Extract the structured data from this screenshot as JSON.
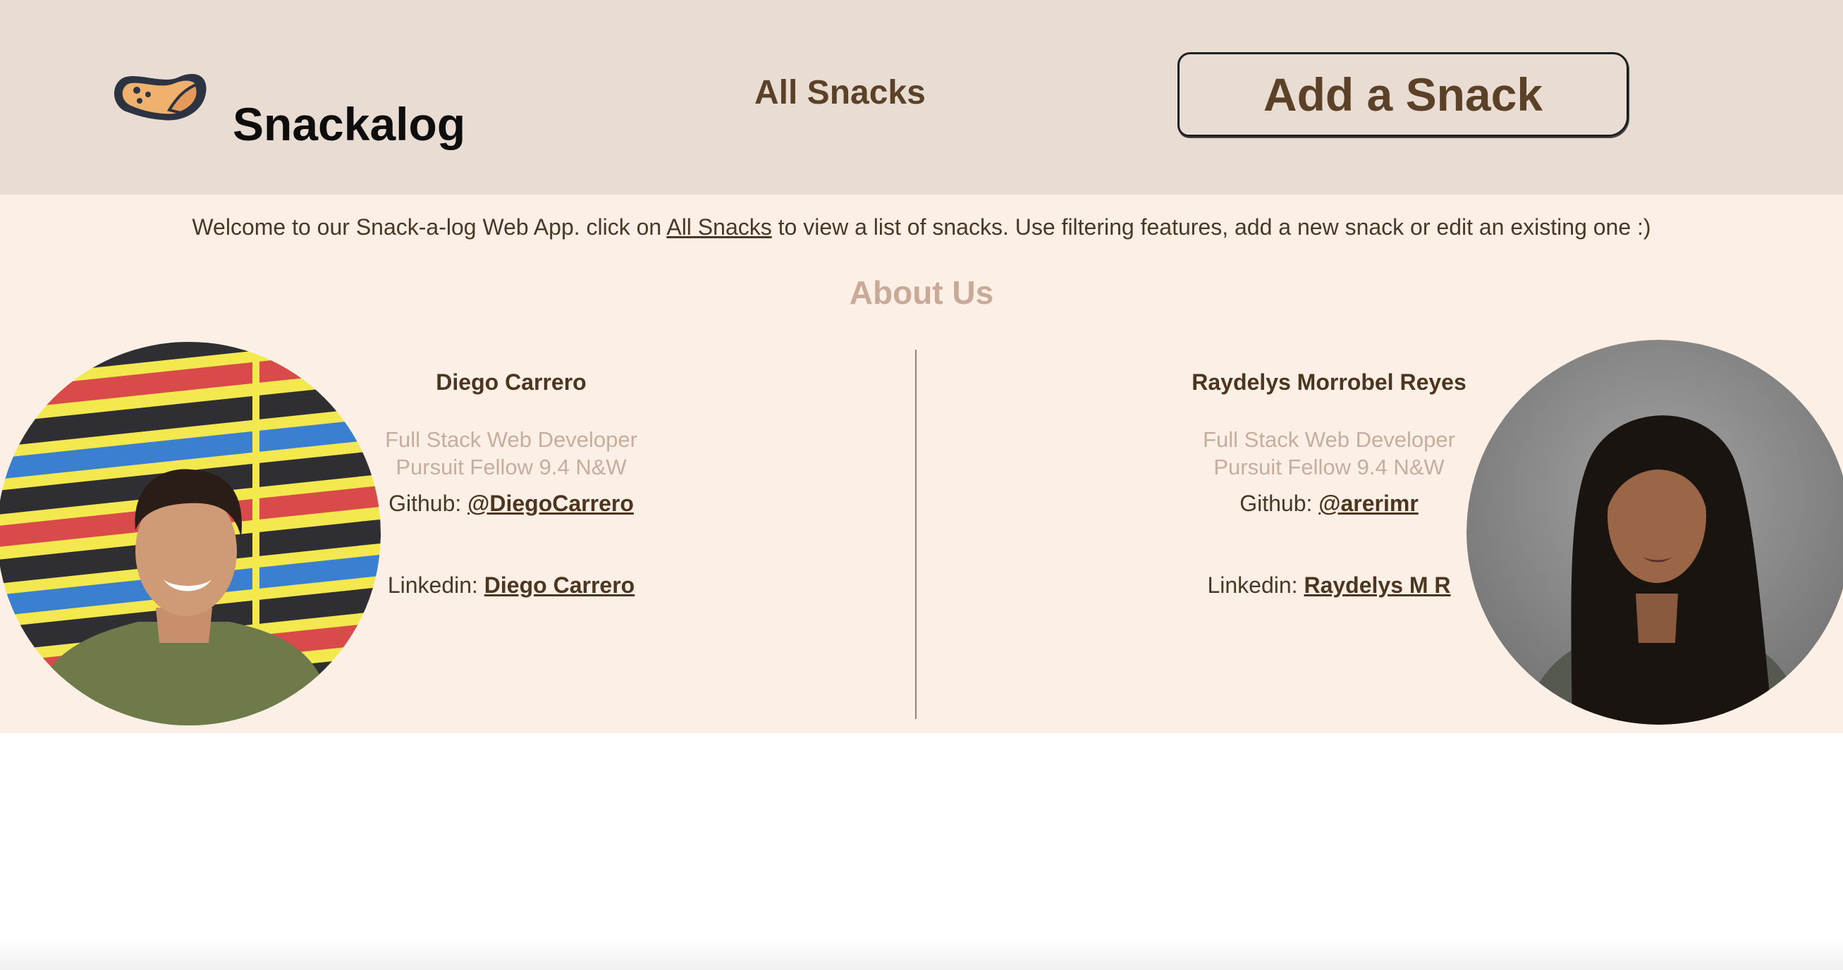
{
  "header": {
    "brand": "Snackalog",
    "nav_all_snacks": "All Snacks",
    "add_snack": "Add a Snack"
  },
  "welcome": {
    "prefix": "Welcome to our Snack-a-log Web App. click on ",
    "link": "All Snacks",
    "suffix": " to view a list of snacks. Use filtering features, add a new snack or edit an existing one :)"
  },
  "about": {
    "title": "About Us",
    "members": [
      {
        "name": "Diego Carrero",
        "role": "Full Stack Web Developer",
        "fellow": "Pursuit Fellow 9.4 N&W",
        "github_label": "Github: ",
        "github_handle": "@DiegoCarrero",
        "linkedin_label": "Linkedin: ",
        "linkedin_name": "Diego Carrero"
      },
      {
        "name": "Raydelys Morrobel Reyes",
        "role": "Full Stack Web Developer",
        "fellow": "Pursuit Fellow 9.4 N&W",
        "github_label": "Github: ",
        "github_handle": "@arerimr",
        "linkedin_label": "Linkedin: ",
        "linkedin_name": "Raydelys M R"
      }
    ]
  },
  "colors": {
    "header_bg": "#e9ddd3",
    "content_bg": "#fbefe6",
    "brown": "#5a4128",
    "muted_pink": "#c9aa99"
  },
  "icons": {
    "logo": "snack-bean-logo-icon"
  }
}
